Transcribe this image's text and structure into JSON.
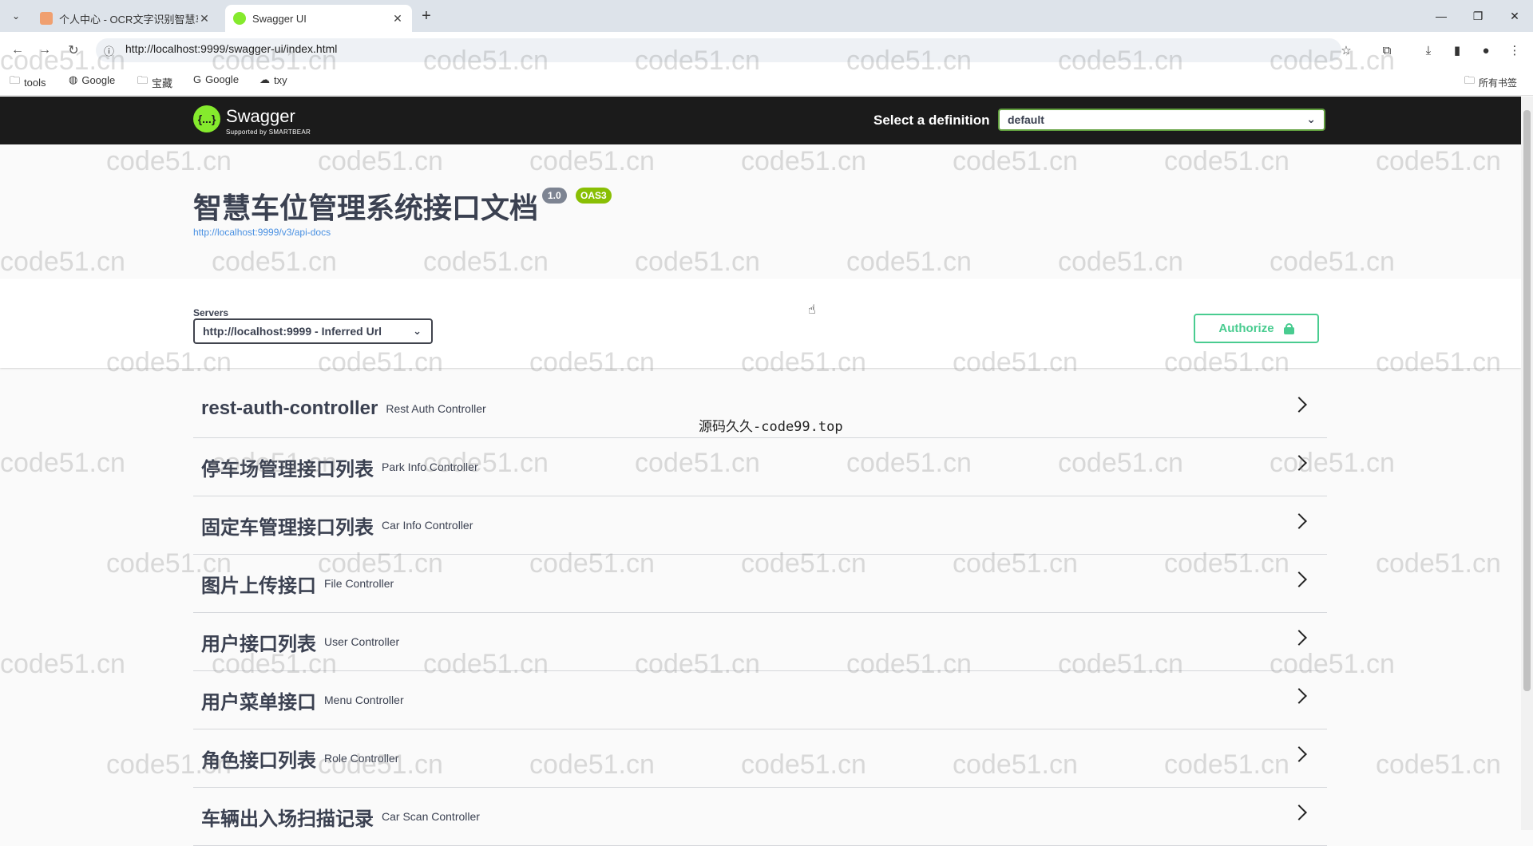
{
  "browser": {
    "tabs": [
      {
        "title": "个人中心 - OCR文字识别智慧车位",
        "active": false
      },
      {
        "title": "Swagger UI",
        "active": true
      }
    ],
    "url": "http://localhost:9999/swagger-ui/index.html",
    "bookmarks": [
      "tools",
      "Google",
      "宝藏",
      "Google",
      "txy"
    ],
    "all_bookmarks": "所有书签"
  },
  "swagger": {
    "logo_text": "Swagger",
    "logo_sub": "Supported by SMARTBEAR",
    "logo_icon": "{...}",
    "select_definition_label": "Select a definition",
    "definition": "default",
    "title": "智慧车位管理系统接口文档",
    "version": "1.0",
    "oas": "OAS3",
    "api_docs_url": "http://localhost:9999/v3/api-docs",
    "servers_label": "Servers",
    "server": "http://localhost:9999 - Inferred Url",
    "authorize_label": "Authorize",
    "tags": [
      {
        "name": "rest-auth-controller",
        "desc": "Rest Auth Controller"
      },
      {
        "name": "停车场管理接口列表",
        "desc": "Park Info Controller"
      },
      {
        "name": "固定车管理接口列表",
        "desc": "Car Info Controller"
      },
      {
        "name": "图片上传接口",
        "desc": "File Controller"
      },
      {
        "name": "用户接口列表",
        "desc": "User Controller"
      },
      {
        "name": "用户菜单接口",
        "desc": "Menu Controller"
      },
      {
        "name": "角色接口列表",
        "desc": "Role Controller"
      },
      {
        "name": "车辆出入场扫描记录",
        "desc": "Car Scan Controller"
      }
    ]
  },
  "overlay_text": "源码久久-code99.top",
  "watermark": "code51.cn",
  "colors": {
    "accent": "#85ea2d",
    "authorize": "#49cc90",
    "topbar": "#1b1b1b",
    "oas_badge": "#89bf04"
  }
}
